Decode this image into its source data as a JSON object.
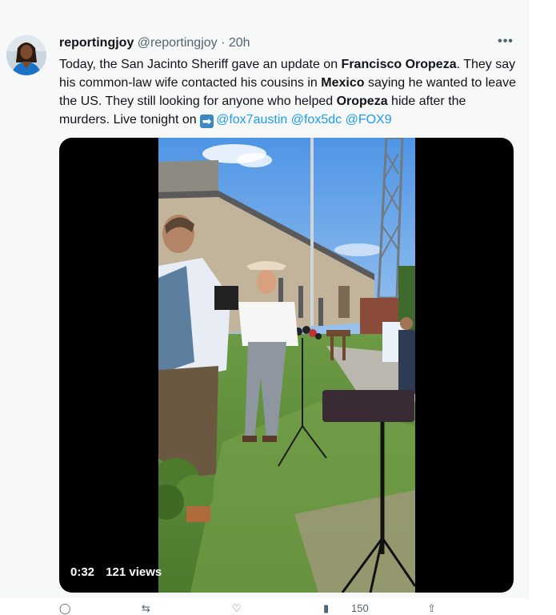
{
  "tweet": {
    "display_name": "reportingjoy",
    "handle": "@reportingjoy",
    "separator": "·",
    "time": "20h",
    "more_label": "•••",
    "text": {
      "p1": "Today, the San Jacinto Sheriff gave an update on ",
      "name": "Francisco Oropeza",
      "p2": ". They say his common-law wife contacted his cousins in ",
      "country": "Mexico",
      "p3": " saying he wanted to leave the US. They still looking for anyone who helped ",
      "name_short": "Oropeza",
      "p4": " hide after the murders. Live tonight on ",
      "arrow": "➡",
      "mentions": [
        "@fox7austin",
        "@fox5dc",
        "@FOX9"
      ]
    },
    "video": {
      "duration": "0:32",
      "views": "121 views"
    },
    "actions": {
      "views_count": "150"
    }
  },
  "colors": {
    "accent": "#1d9bf0",
    "text": "#0f1419",
    "muted": "#536471",
    "background": "#f7f9f9"
  },
  "icons": {
    "more": "more-dots-icon",
    "arrow": "right-arrow-emoji",
    "reply": "reply-icon",
    "retweet": "retweet-icon",
    "like": "heart-icon",
    "views": "views-icon",
    "share": "share-icon"
  }
}
